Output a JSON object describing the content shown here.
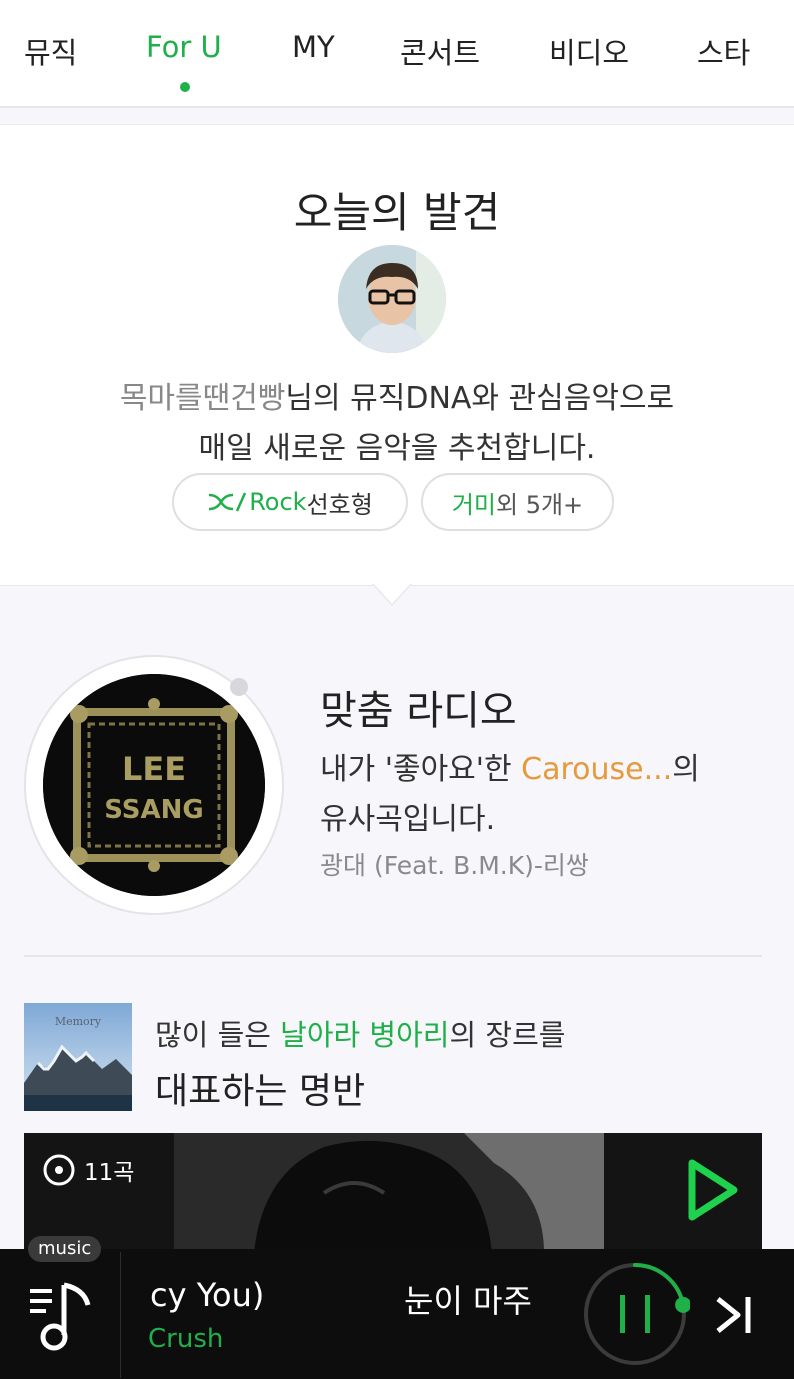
{
  "tabs": [
    {
      "label": "뮤직"
    },
    {
      "label": "For U"
    },
    {
      "label": "MY"
    },
    {
      "label": "콘서트"
    },
    {
      "label": "비디오"
    },
    {
      "label": "스타"
    }
  ],
  "active_tab": "For U",
  "discovery": {
    "title": "오늘의 발견",
    "nickname": "목마를땐건빵",
    "line1_suffix": "님의 뮤직DNA와 관심음악으로",
    "line2": "매일 새로운 음악을 추천합니다.",
    "genre_pill": {
      "highlight": "Rock",
      "suffix": "선호형"
    },
    "artist_pill": {
      "highlight": "거미",
      "suffix": "외 5개+"
    }
  },
  "radio": {
    "title": "맞춤 라디오",
    "desc_prefix": "내가 '좋아요'한 ",
    "desc_track": "Carouse...",
    "desc_suffix": "의",
    "desc_line2": "유사곡입니다.",
    "song": "광대 (Feat. B.M.K)-리쌍",
    "cover_text_top": "LEE",
    "cover_text_bottom": "SSANG"
  },
  "album": {
    "thumb_text": "Memory",
    "line1_prefix": "많이 들은 ",
    "line1_highlight": "날아라 병아리",
    "line1_suffix": "의 장르를",
    "line2": "대표하는 명반",
    "track_count": "11곡"
  },
  "player": {
    "badge": "music",
    "current_title": "cy You)",
    "current_artist": "Crush",
    "next_title": "눈이 마주",
    "progress": 0.22
  },
  "colors": {
    "accent_green": "#1fb04a",
    "highlight_orange": "#e69a3b"
  }
}
